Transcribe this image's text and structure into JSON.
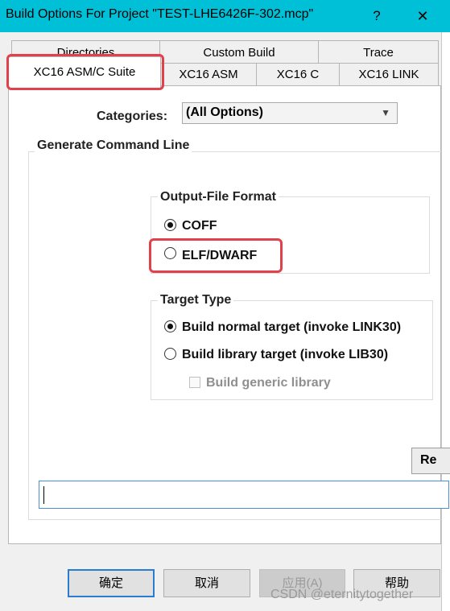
{
  "window": {
    "title": "Build Options For Project \"TEST-LHE6426F-302.mcp\"",
    "help_label": "?",
    "close_label": "✕"
  },
  "tabs": {
    "row_back": [
      "Directories",
      "Custom Build",
      "Trace"
    ],
    "row_front": [
      "XC16 ASM",
      "XC16 C",
      "XC16 LINK"
    ],
    "active": "XC16 ASM/C Suite"
  },
  "categories": {
    "label": "Categories:",
    "selected": "(All Options)"
  },
  "generate_group": {
    "title": "Generate Command Line"
  },
  "output_format": {
    "title": "Output-File Format",
    "options": [
      {
        "label": "COFF",
        "selected": true
      },
      {
        "label": "ELF/DWARF",
        "selected": false
      }
    ]
  },
  "target_type": {
    "title": "Target Type",
    "options": [
      {
        "label": "Build normal target (invoke LINK30)",
        "selected": true
      },
      {
        "label": "Build library target (invoke LIB30)",
        "selected": false
      }
    ],
    "generic_library": {
      "label": "Build generic library",
      "checked": false,
      "enabled": false
    }
  },
  "reset_button": "Re",
  "command_line": {
    "value": ""
  },
  "buttons": {
    "ok": "确定",
    "cancel": "取消",
    "apply": "应用(A)",
    "help": "帮助"
  },
  "watermark": "CSDN @eternitytogether",
  "colors": {
    "titlebar": "#00c0d8",
    "highlight": "#e0414a",
    "focus_border": "#2a7bd2"
  }
}
